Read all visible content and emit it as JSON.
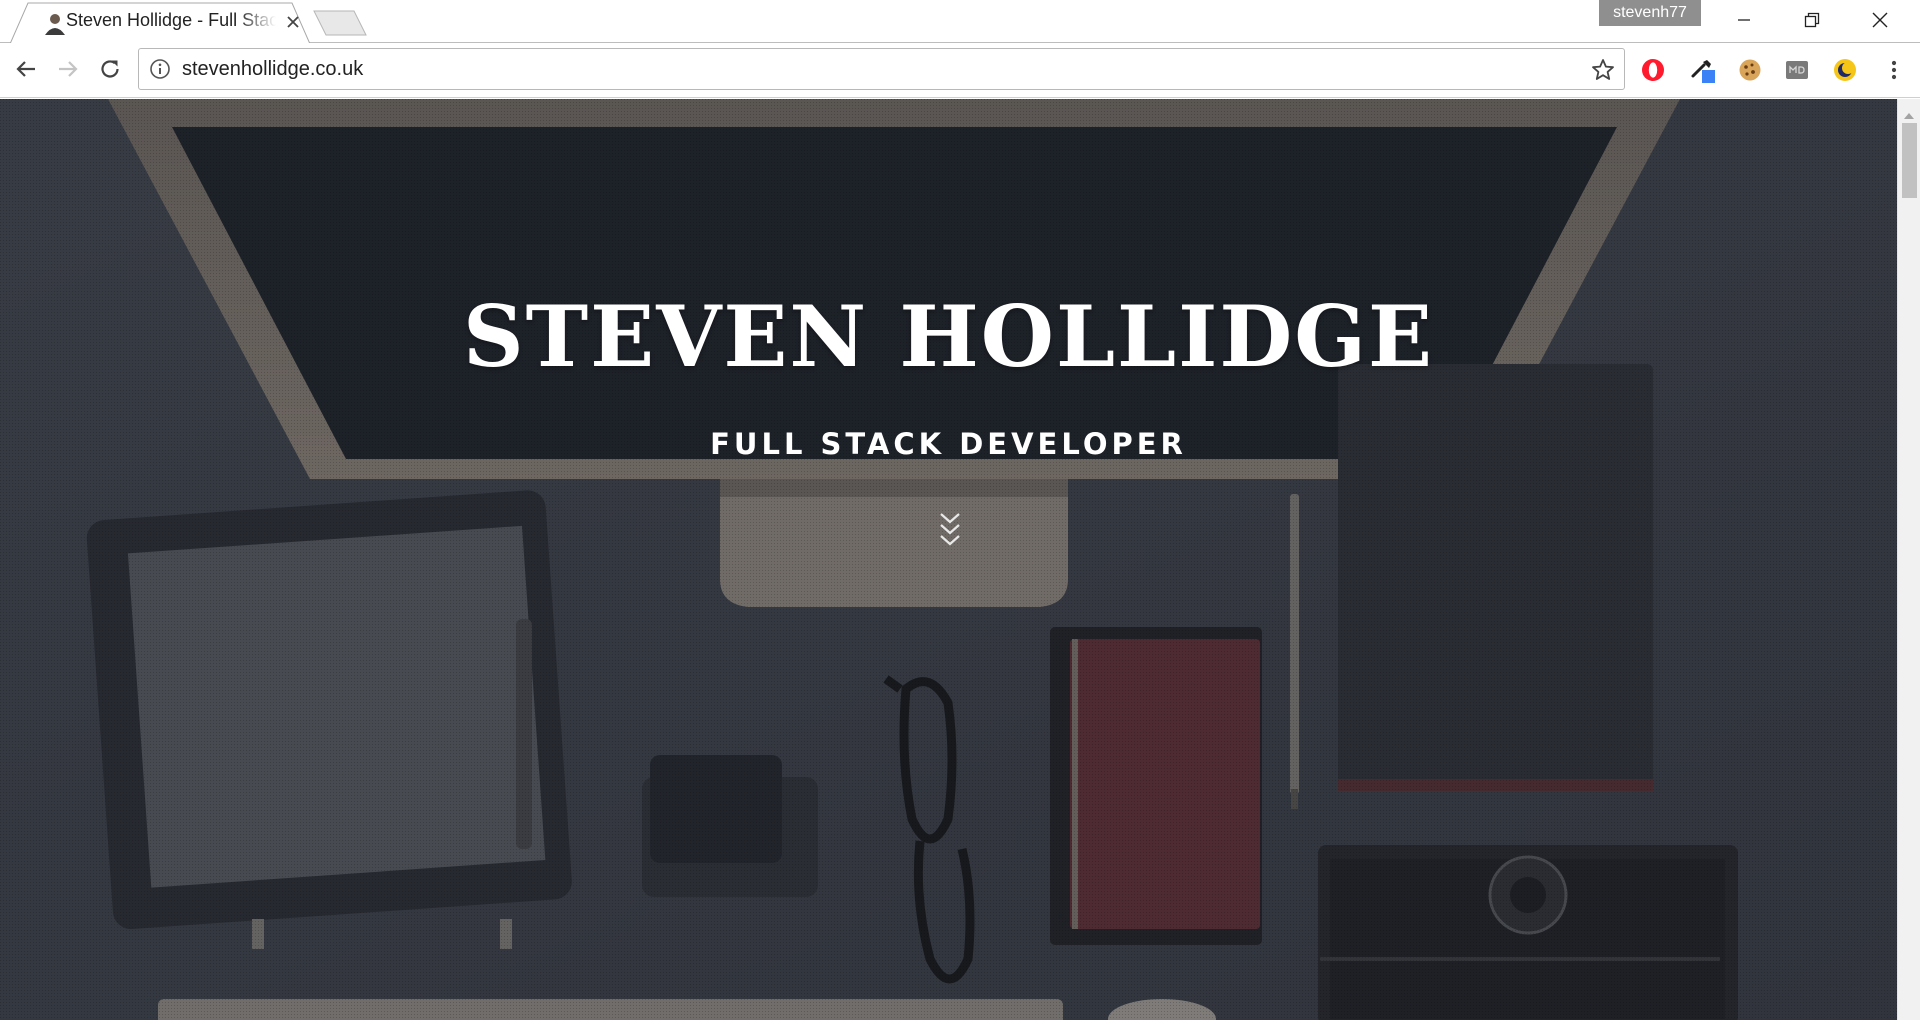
{
  "browser": {
    "tab": {
      "title": "Steven Hollidge - Full Stack Developer",
      "favicon": "avatar-icon",
      "close_icon": "close-icon"
    },
    "new_tab_icon": "new-tab-icon",
    "profile_name": "stevenh77",
    "window_controls": [
      "minimize-icon",
      "restore-icon",
      "close-icon"
    ],
    "toolbar": {
      "back_icon": "back-arrow-icon",
      "forward_icon": "forward-arrow-icon",
      "reload_icon": "reload-icon",
      "info_icon": "info-icon",
      "url": "stevenhollidge.co.uk",
      "bookmark_icon": "star-icon"
    },
    "extensions": [
      "opera-icon",
      "color-picker-icon",
      "cookie-icon",
      "md-icon",
      "night-mode-icon"
    ],
    "menu_icon": "kebab-menu-icon"
  },
  "page": {
    "hero": {
      "name": "STEVEN HOLLIDGE",
      "role": "FULL STACK DEVELOPER",
      "scroll_icon": "chevrons-down-icon"
    },
    "background": "desk-photo-illustration"
  },
  "colors": {
    "overlay": "#3b3f47",
    "screen": "#1b1f26",
    "text": "#ffffff",
    "profile_badge": "#8f8f8f"
  }
}
